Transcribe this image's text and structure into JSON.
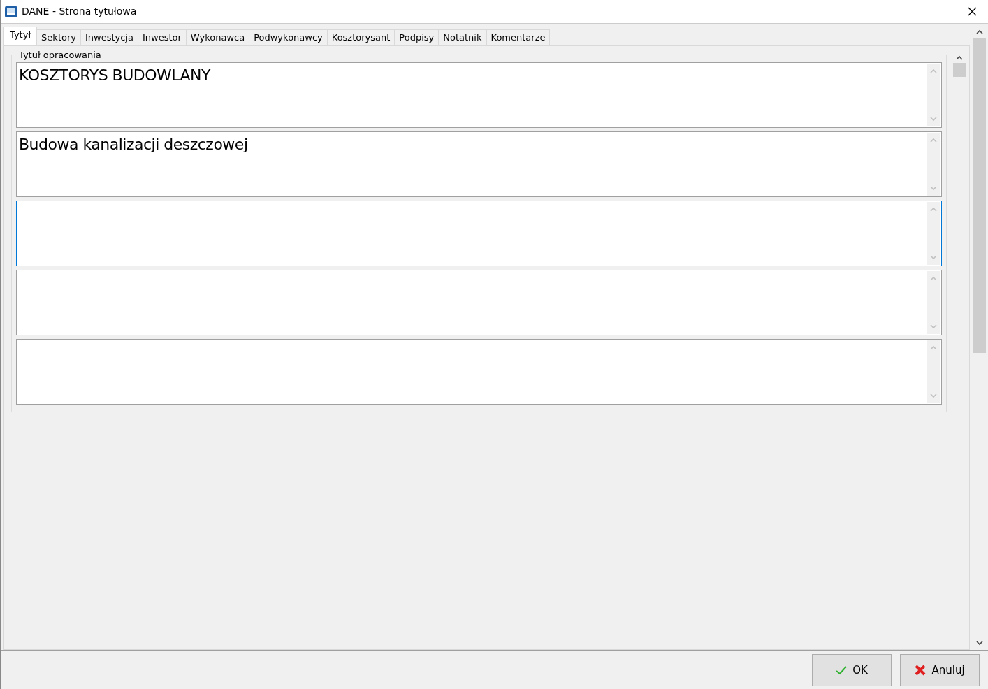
{
  "window": {
    "title": "DANE - Strona tytułowa"
  },
  "tabs": [
    {
      "label": "Tytył",
      "selected": true
    },
    {
      "label": "Sektory",
      "selected": false
    },
    {
      "label": "Inwestycja",
      "selected": false
    },
    {
      "label": "Inwestor",
      "selected": false
    },
    {
      "label": "Wykonawca",
      "selected": false
    },
    {
      "label": "Podwykonawcy",
      "selected": false
    },
    {
      "label": "Kosztorysant",
      "selected": false
    },
    {
      "label": "Podpisy",
      "selected": false
    },
    {
      "label": "Notatnik",
      "selected": false
    },
    {
      "label": "Komentarze",
      "selected": false
    }
  ],
  "group": {
    "title": "Tytuł opracowania",
    "fields": [
      {
        "value": "KOSZTORYS BUDOWLANY",
        "focused": false
      },
      {
        "value": "Budowa kanalizacji deszczowej",
        "focused": false
      },
      {
        "focused": true
      },
      {
        "focused": false
      },
      {
        "focused": false
      }
    ]
  },
  "buttons": [
    {
      "kind": "ok",
      "label": "OK"
    },
    {
      "kind": "cancel",
      "label": "Anuluj"
    }
  ]
}
